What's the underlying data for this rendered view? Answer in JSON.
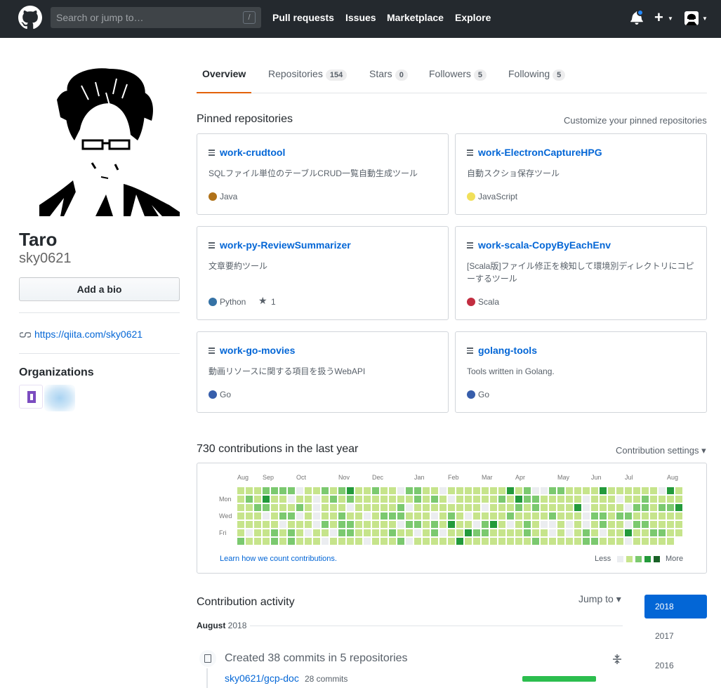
{
  "header": {
    "search_placeholder": "Search or jump to…",
    "slash": "/",
    "nav": [
      "Pull requests",
      "Issues",
      "Marketplace",
      "Explore"
    ],
    "icons": [
      "github-logo-icon",
      "bell-icon",
      "plus-icon",
      "avatar"
    ]
  },
  "profile": {
    "name": "Taro",
    "login": "sky0621",
    "bio_button": "Add a bio",
    "url": "https://qiita.com/sky0621",
    "orgs_title": "Organizations"
  },
  "tabs": [
    {
      "label": "Overview",
      "count": ""
    },
    {
      "label": "Repositories",
      "count": "154"
    },
    {
      "label": "Stars",
      "count": "0"
    },
    {
      "label": "Followers",
      "count": "5"
    },
    {
      "label": "Following",
      "count": "5"
    }
  ],
  "pinned": {
    "title": "Pinned repositories",
    "customize": "Customize your pinned repositories",
    "repos": [
      {
        "name": "work-crudtool",
        "desc": "SQLファイル単位のテーブルCRUD一覧自動生成ツール",
        "lang": "Java",
        "color": "#b07219",
        "stars": ""
      },
      {
        "name": "work-ElectronCaptureHPG",
        "desc": "自動スクショ保存ツール",
        "lang": "JavaScript",
        "color": "#f1e05a",
        "stars": ""
      },
      {
        "name": "work-py-ReviewSummarizer",
        "desc": "文章要約ツール",
        "lang": "Python",
        "color": "#3572A5",
        "stars": "1"
      },
      {
        "name": "work-scala-CopyByEachEnv",
        "desc": "[Scala版]ファイル修正を検知して環境別ディレクトリにコピーするツール",
        "lang": "Scala",
        "color": "#c22d40",
        "stars": ""
      },
      {
        "name": "work-go-movies",
        "desc": "動画リソースに関する項目を扱うWebAPI",
        "lang": "Go",
        "color": "#375eab",
        "stars": ""
      },
      {
        "name": "golang-tools",
        "desc": "Tools written in Golang.",
        "lang": "Go",
        "color": "#375eab",
        "stars": ""
      }
    ]
  },
  "contributions": {
    "title": "730 contributions in the last year",
    "settings": "Contribution settings",
    "months": [
      "Aug",
      "Sep",
      "Oct",
      "Nov",
      "Dec",
      "Jan",
      "Feb",
      "Mar",
      "Apr",
      "May",
      "Jun",
      "Jul",
      "Aug"
    ],
    "days": [
      "Mon",
      "Wed",
      "Fri"
    ],
    "learn": "Learn how we count contributions.",
    "less": "Less",
    "more": "More",
    "colors": [
      "#ebedf0",
      "#c6e48b",
      "#7bc96f",
      "#239a3b",
      "#196127"
    ],
    "levels": "1111112121110111211112320111211112221120112012122012011111111011000011211121012111012112221320122111111111110110211111111121111112121012201221012102211201111111112102210111101101231111111131110131111102111012211111311121111131120111321111221122102211120111011211200121111111111001113111110000221112112311220111111111012111110203011212111221211111112101211213121111113111112200102211211012111121111112111222112112111121111221122111111111131"
  },
  "activity": {
    "title": "Contribution activity",
    "jump": "Jump to",
    "month": "August",
    "year": "2018",
    "years": [
      "2018",
      "2017",
      "2016"
    ],
    "created": "Created 38 commits in 5 repositories",
    "repo": "sky0621/gcp-doc",
    "repo_commits": "28 commits",
    "repo_commits_value": 28
  }
}
